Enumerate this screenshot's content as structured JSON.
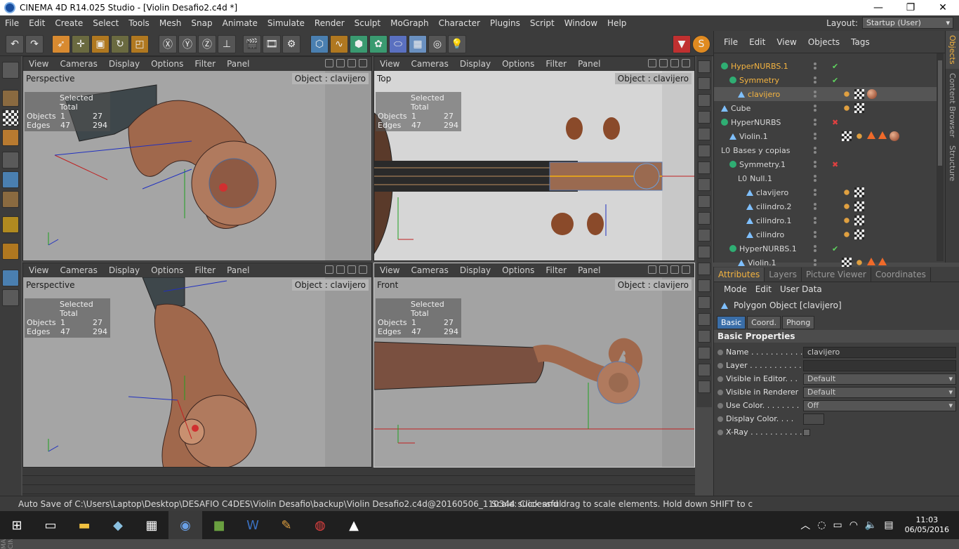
{
  "window": {
    "title": "CINEMA 4D R14.025 Studio - [Violin Desafio2.c4d *]"
  },
  "menu": [
    "File",
    "Edit",
    "Create",
    "Select",
    "Tools",
    "Mesh",
    "Snap",
    "Animate",
    "Simulate",
    "Render",
    "Sculpt",
    "MoGraph",
    "Character",
    "Plugins",
    "Script",
    "Window",
    "Help"
  ],
  "layout": {
    "label": "Layout:",
    "value": "Startup (User)"
  },
  "viewport_menu": [
    "View",
    "Cameras",
    "Display",
    "Options",
    "Filter",
    "Panel"
  ],
  "viewports": [
    {
      "name": "Perspective",
      "object": "Object : clavijero"
    },
    {
      "name": "Top",
      "object": "Object : clavijero"
    },
    {
      "name": "Perspective",
      "object": "Object : clavijero"
    },
    {
      "name": "Front",
      "object": "Object : clavijero"
    }
  ],
  "hud": {
    "header": "Selected Total",
    "rows": [
      {
        "label": "Objects",
        "sel": "1",
        "total": "27"
      },
      {
        "label": "Edges",
        "sel": "47",
        "total": "294"
      }
    ]
  },
  "objects_menu": [
    "File",
    "Edit",
    "View",
    "Objects",
    "Tags"
  ],
  "object_tree": [
    {
      "name": "HyperNURBS.1",
      "type": "nurbs",
      "indent": 0,
      "color": "#f5b440",
      "flag": "✔",
      "flagcolor": "#5fd35f",
      "tags": []
    },
    {
      "name": "Symmetry",
      "type": "nurbs",
      "indent": 1,
      "color": "#f5b440",
      "flag": "✔",
      "flagcolor": "#5fd35f",
      "tags": []
    },
    {
      "name": "clavijero",
      "type": "poly",
      "indent": 2,
      "color": "#f5b440",
      "flag": "",
      "flagcolor": "",
      "tags": [
        "dot",
        "chk",
        "mat"
      ],
      "selected": true
    },
    {
      "name": "Cube",
      "type": "poly",
      "indent": 0,
      "color": "#d8d8d8",
      "flag": "",
      "flagcolor": "",
      "tags": [
        "dot",
        "chk"
      ]
    },
    {
      "name": "HyperNURBS",
      "type": "nurbs",
      "indent": 0,
      "color": "#d8d8d8",
      "flag": "✖",
      "flagcolor": "#e04040",
      "tags": []
    },
    {
      "name": "Violin.1",
      "type": "poly",
      "indent": 1,
      "color": "#d8d8d8",
      "flag": "",
      "flagcolor": "",
      "tags": [
        "chk",
        "dot",
        "tri",
        "tri",
        "mat"
      ]
    },
    {
      "name": "Bases y copias",
      "type": "null",
      "indent": 0,
      "color": "#d8d8d8",
      "flag": "",
      "flagcolor": "",
      "tags": []
    },
    {
      "name": "Symmetry.1",
      "type": "nurbs",
      "indent": 1,
      "color": "#d8d8d8",
      "flag": "✖",
      "flagcolor": "#e04040",
      "tags": []
    },
    {
      "name": "Null.1",
      "type": "null",
      "indent": 2,
      "color": "#d8d8d8",
      "flag": "",
      "flagcolor": "",
      "tags": []
    },
    {
      "name": "clavijero",
      "type": "poly",
      "indent": 3,
      "color": "#d8d8d8",
      "flag": "",
      "flagcolor": "",
      "tags": [
        "dot",
        "chk"
      ]
    },
    {
      "name": "cilindro.2",
      "type": "poly",
      "indent": 3,
      "color": "#d8d8d8",
      "flag": "",
      "flagcolor": "",
      "tags": [
        "dot",
        "chk"
      ]
    },
    {
      "name": "cilindro.1",
      "type": "poly",
      "indent": 3,
      "color": "#d8d8d8",
      "flag": "",
      "flagcolor": "",
      "tags": [
        "dot",
        "chk"
      ]
    },
    {
      "name": "cilindro",
      "type": "poly",
      "indent": 3,
      "color": "#d8d8d8",
      "flag": "",
      "flagcolor": "",
      "tags": [
        "dot",
        "chk"
      ]
    },
    {
      "name": "HyperNURBS.1",
      "type": "nurbs",
      "indent": 1,
      "color": "#d8d8d8",
      "flag": "✔",
      "flagcolor": "#5fd35f",
      "tags": []
    },
    {
      "name": "Violin.1",
      "type": "poly",
      "indent": 2,
      "color": "#d8d8d8",
      "flag": "",
      "flagcolor": "",
      "tags": [
        "chk",
        "dot",
        "tri",
        "tri"
      ]
    }
  ],
  "side_tabs": [
    "Objects",
    "Content Browser",
    "Structure"
  ],
  "attr_tabs": [
    "Attributes",
    "Layers",
    "Picture Viewer",
    "Coordinates"
  ],
  "attr_menu": [
    "Mode",
    "Edit",
    "User Data"
  ],
  "attr": {
    "title": "Polygon Object [clavijero]",
    "subtabs": [
      "Basic",
      "Coord.",
      "Phong"
    ],
    "section": "Basic Properties",
    "props": [
      {
        "label": "Name . . . . . . . . . . . .",
        "value": "clavijero",
        "kind": "text"
      },
      {
        "label": "Layer . . . . . . . . . . . .",
        "value": "",
        "kind": "text"
      },
      {
        "label": "Visible in Editor. . .",
        "value": "Default",
        "kind": "dd"
      },
      {
        "label": "Visible in Renderer",
        "value": "Default",
        "kind": "dd"
      },
      {
        "label": "Use Color. . . . . . . .",
        "value": "Off",
        "kind": "dd"
      },
      {
        "label": "Display Color. . . .",
        "value": "",
        "kind": "swatch"
      },
      {
        "label": "X-Ray . . . . . . . . . . .",
        "value": "",
        "kind": "check"
      }
    ]
  },
  "status": {
    "left": "Auto Save of C:\\Users\\Laptop\\Desktop\\DESAFIO C4DES\\Violin Desafio\\backup\\Violin Desafio2.c4d@20160506_110344 successful",
    "right": "Scale: Click and drag to scale elements. Hold down SHIFT to c"
  },
  "brand": "MAXON CINEMA 4D",
  "clock": {
    "time": "11:03",
    "date": "06/05/2016"
  }
}
